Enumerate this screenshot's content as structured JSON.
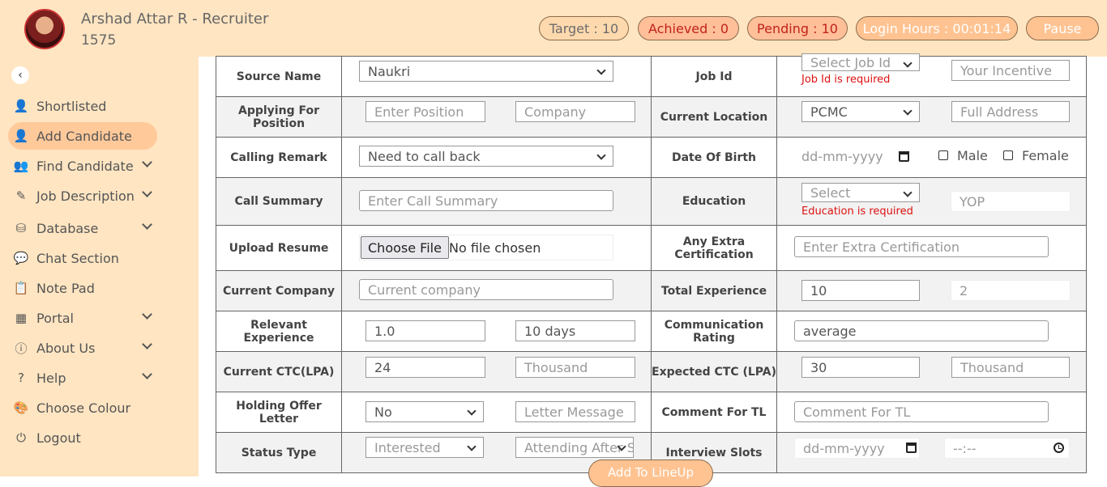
{
  "header": {
    "user_name": "Arshad Attar R - Recruiter",
    "user_id": "1575",
    "target": "Target : 10",
    "achieved": "Achieved : 0",
    "pending": "Pending : 10",
    "login_hours": "Login Hours : 00:01:14",
    "pause": "Pause"
  },
  "sidebar": {
    "collapse_icon": "chevron-left-icon",
    "items": [
      {
        "label": "Shortlisted",
        "icon": "user-check-icon"
      },
      {
        "label": "Add Candidate",
        "icon": "user-plus-icon"
      },
      {
        "label": "Find Candidate",
        "icon": "users-icon"
      },
      {
        "label": "Job Description",
        "icon": "edit-icon"
      },
      {
        "label": "Database",
        "icon": "database-icon"
      },
      {
        "label": "Chat Section",
        "icon": "chat-icon"
      },
      {
        "label": "Note Pad",
        "icon": "clipboard-icon"
      },
      {
        "label": "Portal",
        "icon": "table-icon"
      },
      {
        "label": "About Us",
        "icon": "info-icon"
      },
      {
        "label": "Help",
        "icon": "question-icon"
      },
      {
        "label": "Choose Colour",
        "icon": "palette-icon"
      },
      {
        "label": "Logout",
        "icon": "power-icon"
      }
    ]
  },
  "form": {
    "source_name": {
      "label": "Source Name",
      "value": "Naukri"
    },
    "job_id": {
      "label": "Job Id",
      "placeholder": "Select Job Id",
      "error": "Job Id is required",
      "incentive_placeholder": "Your Incentive"
    },
    "position": {
      "label": "Applying For Position",
      "placeholder": "Enter Position",
      "company_placeholder": "Company"
    },
    "current_location": {
      "label": "Current Location",
      "value": "PCMC",
      "address_placeholder": "Full Address"
    },
    "calling_remark": {
      "label": "Calling Remark",
      "value": "Need to call back"
    },
    "dob": {
      "label": "Date Of Birth",
      "placeholder": "dd-mm-yyyy",
      "male": "Male",
      "female": "Female"
    },
    "call_summary": {
      "label": "Call Summary",
      "placeholder": "Enter Call Summary"
    },
    "education": {
      "label": "Education",
      "placeholder": "Select",
      "error": "Education is required",
      "yop_placeholder": "YOP"
    },
    "resume": {
      "label": "Upload Resume",
      "button": "Choose File",
      "status": "No file chosen"
    },
    "certification": {
      "label": "Any Extra Certification",
      "placeholder": "Enter Extra Certification"
    },
    "current_company": {
      "label": "Current Company",
      "placeholder": "Current company"
    },
    "total_experience": {
      "label": "Total Experience",
      "years": "10",
      "months": "2"
    },
    "relevant_experience": {
      "label": "Relevant Experience",
      "value": "1.0",
      "notice": "10 days"
    },
    "communication": {
      "label": "Communication Rating",
      "value": "average"
    },
    "current_ctc": {
      "label": "Current CTC(LPA)",
      "value": "24",
      "thousand_placeholder": "Thousand"
    },
    "expected_ctc": {
      "label": "Expected CTC (LPA)",
      "value": "30",
      "thousand_placeholder": "Thousand"
    },
    "holding_offer": {
      "label": "Holding Offer Letter",
      "value": "No",
      "letter_placeholder": "Letter Message"
    },
    "comment_tl": {
      "label": "Comment For TL",
      "placeholder": "Comment For TL"
    },
    "status_type": {
      "label": "Status Type",
      "value": "Interested",
      "attending": "Attending After S"
    },
    "interview_slots": {
      "label": "Interview Slots",
      "date_placeholder": "dd-mm-yyyy",
      "time_placeholder": "--:--"
    }
  },
  "submit": "Add To LineUp"
}
